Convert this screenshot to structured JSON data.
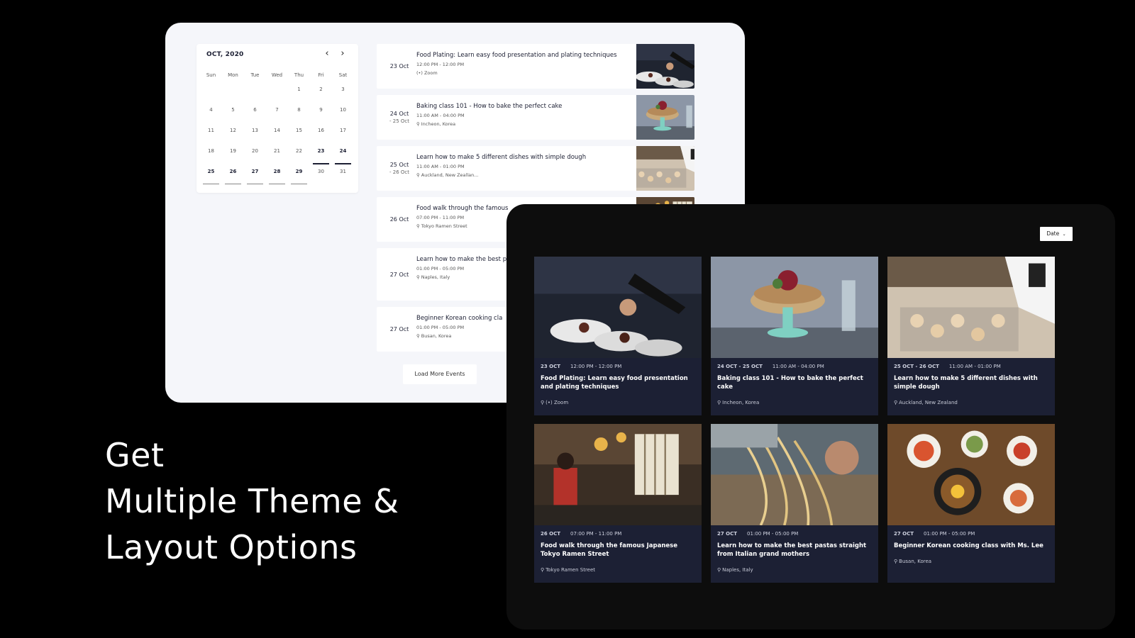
{
  "calendar": {
    "month_label": "OCT, 2020",
    "prev_icon": "chevron-left-icon",
    "next_icon": "chevron-right-icon",
    "weekdays": [
      "Sun",
      "Mon",
      "Tue",
      "Wed",
      "Thu",
      "Fri",
      "Sat"
    ],
    "days": [
      "",
      "",
      "",
      "",
      "1",
      "2",
      "3",
      "4",
      "5",
      "6",
      "7",
      "8",
      "9",
      "10",
      "11",
      "12",
      "13",
      "14",
      "15",
      "16",
      "17",
      "18",
      "19",
      "20",
      "21",
      "22",
      "23",
      "24",
      "25",
      "26",
      "27",
      "28",
      "29",
      "30",
      "31"
    ],
    "event_days": [
      "23",
      "24",
      "25",
      "26",
      "27",
      "28",
      "29"
    ],
    "selected_days": [
      "23",
      "24"
    ]
  },
  "event_list": {
    "items": [
      {
        "date": "23 Oct",
        "date_end": "",
        "title": "Food Plating: Learn easy food presentation and plating techniques",
        "time": "12:00 PM - 12:00 PM",
        "location": "(•) Zoom"
      },
      {
        "date": "24 Oct",
        "date_end": "- 25 Oct",
        "title": "Baking class 101 - How to bake the perfect cake",
        "time": "11:00 AM - 04:00 PM",
        "location": "Incheon, Korea"
      },
      {
        "date": "25 Oct",
        "date_end": "- 26 Oct",
        "title": "Learn how to make 5 different dishes with simple dough",
        "time": "11:00 AM - 01:00 PM",
        "location": "Auckland, New Zeallan..."
      },
      {
        "date": "26 Oct",
        "date_end": "",
        "title": "Food walk through the famous",
        "time": "07:00 PM - 11:00 PM",
        "location": "Tokyo Ramen Street"
      },
      {
        "date": "27 Oct",
        "date_end": "",
        "title": "Learn how to make the best p mothers",
        "time": "01:00 PM - 05:00 PM",
        "location": "Naples, Italy"
      },
      {
        "date": "27 Oct",
        "date_end": "",
        "title": "Beginner Korean cooking cla",
        "time": "01:00 PM - 05:00 PM",
        "location": "Busan, Korea"
      }
    ],
    "load_more_label": "Load More Events"
  },
  "grid": {
    "sort_label": "Date",
    "cards": [
      {
        "date": "23 OCT",
        "time": "12:00 PM - 12:00 PM",
        "title": "Food Plating: Learn easy food presentation and plating techniques",
        "location": "(•) Zoom"
      },
      {
        "date": "24 OCT - 25 OCT",
        "time": "11:00 AM - 04:00 PM",
        "title": "Baking class 101 - How to bake the perfect cake",
        "location": "Incheon, Korea"
      },
      {
        "date": "25 OCT - 26 OCT",
        "time": "11:00 AM - 01:00 PM",
        "title": "Learn how to make 5 different dishes with simple dough",
        "location": "Auckland, New Zealand"
      },
      {
        "date": "26 OCT",
        "time": "07:00 PM - 11:00 PM",
        "title": "Food walk through the famous Japanese Tokyo Ramen Street",
        "location": "Tokyo Ramen Street"
      },
      {
        "date": "27 OCT",
        "time": "01:00 PM - 05:00 PM",
        "title": "Learn how to make the best pastas straight from Italian grand mothers",
        "location": "Naples, Italy"
      },
      {
        "date": "27 OCT",
        "time": "01:00 PM - 05:00 PM",
        "title": "Beginner Korean cooking class with Ms. Lee",
        "location": "Busan, Korea"
      }
    ]
  },
  "headline": {
    "line1": "Get",
    "line2": "Multiple Theme &",
    "line3": "Layout Options"
  },
  "colors": {
    "page_bg": "#000000",
    "light_bg": "#f5f6fa",
    "dark_bg": "#0d0d0d",
    "card_bg": "#1c2034",
    "text_dark": "#1c1f33"
  }
}
